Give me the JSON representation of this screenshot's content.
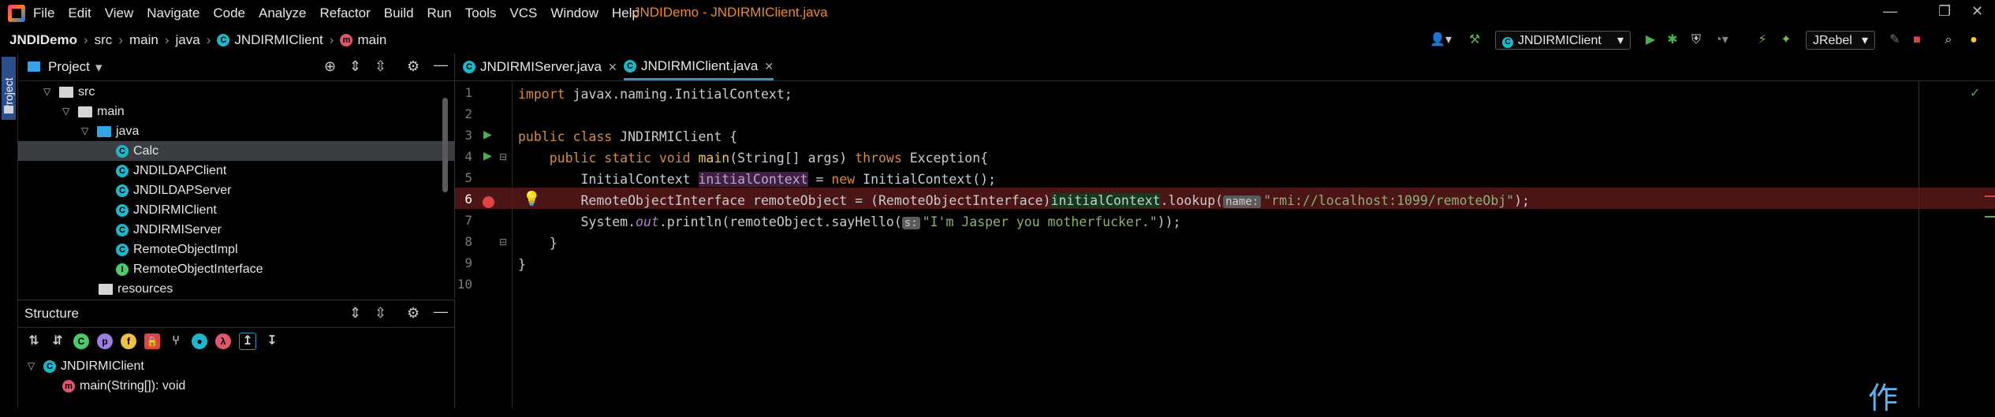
{
  "menu": [
    "File",
    "Edit",
    "View",
    "Navigate",
    "Code",
    "Analyze",
    "Refactor",
    "Build",
    "Run",
    "Tools",
    "VCS",
    "Window",
    "Help"
  ],
  "window_title": "JNDIDemo - JNDIRMIClient.java",
  "window_controls": {
    "minimize": "—",
    "restore": "❐",
    "close": "✕"
  },
  "breadcrumb": {
    "project": "JNDIDemo",
    "items": [
      "src",
      "main",
      "java",
      "JNDIRMIClient",
      "main"
    ]
  },
  "toolbar": {
    "run_config": "JNDIRMIClient",
    "jrebel": "JRebel",
    "dropdown": "▾"
  },
  "stripe": {
    "project_label": "Project"
  },
  "project_panel": {
    "title": "Project",
    "tree": [
      {
        "label": "src",
        "type": "folder",
        "indent": 0,
        "expanded": true
      },
      {
        "label": "main",
        "type": "folder",
        "indent": 1,
        "expanded": true
      },
      {
        "label": "java",
        "type": "folder-blue",
        "indent": 2,
        "expanded": true
      },
      {
        "label": "Calc",
        "type": "class",
        "indent": 3,
        "selected": true
      },
      {
        "label": "JNDILDAPClient",
        "type": "class",
        "indent": 3
      },
      {
        "label": "JNDILDAPServer",
        "type": "class",
        "indent": 3
      },
      {
        "label": "JNDIRMIClient",
        "type": "class",
        "indent": 3
      },
      {
        "label": "JNDIRMIServer",
        "type": "class",
        "indent": 3
      },
      {
        "label": "RemoteObjectImpl",
        "type": "class",
        "indent": 3
      },
      {
        "label": "RemoteObjectInterface",
        "type": "interface",
        "indent": 3
      },
      {
        "label": "resources",
        "type": "folder",
        "indent": 2
      }
    ]
  },
  "structure_panel": {
    "title": "Structure",
    "items": [
      {
        "label": "JNDIRMIClient",
        "kind": "class"
      },
      {
        "label": "main(String[]): void",
        "kind": "method"
      }
    ]
  },
  "tabs": [
    {
      "label": "JNDIRMIServer.java",
      "active": false
    },
    {
      "label": "JNDIRMIClient.java",
      "active": true
    }
  ],
  "code": {
    "line_numbers": [
      "1",
      "2",
      "3",
      "4",
      "5",
      "6",
      "7",
      "8",
      "9",
      "10"
    ],
    "l1": {
      "kw": "import",
      "rest": " javax.naming.InitialContext;"
    },
    "l3": {
      "kw": "public class",
      "rest": " JNDIRMIClient {"
    },
    "l4": {
      "indent": "    ",
      "kw1": "public static void",
      "fn": " main",
      "mid": "(String[] args) ",
      "kw2": "throws",
      "rest": " Exception{"
    },
    "l5": {
      "indent": "        ",
      "type": "InitialContext ",
      "var": "initialContext",
      "eq": " = ",
      "kw": "new",
      "rest": " InitialContext();"
    },
    "l6": {
      "indent": "        ",
      "pre": "RemoteObjectInterface remoteObject = (RemoteObjectInterface)",
      "var": "initialContext",
      "call": ".lookup(",
      "hint": "name:",
      "str": "\"rmi://localhost:1099/remoteObj\"",
      "end": ");"
    },
    "l7": {
      "indent": "        ",
      "pre": "System.",
      "static": "out",
      "mid": ".println(remoteObject.sayHello(",
      "hint": "s:",
      "str": "\"I'm Jasper you motherfucker.\"",
      "end": "));"
    },
    "l8": {
      "indent": "    ",
      "text": "}"
    },
    "l9": {
      "text": "}"
    }
  },
  "watermark": "作"
}
